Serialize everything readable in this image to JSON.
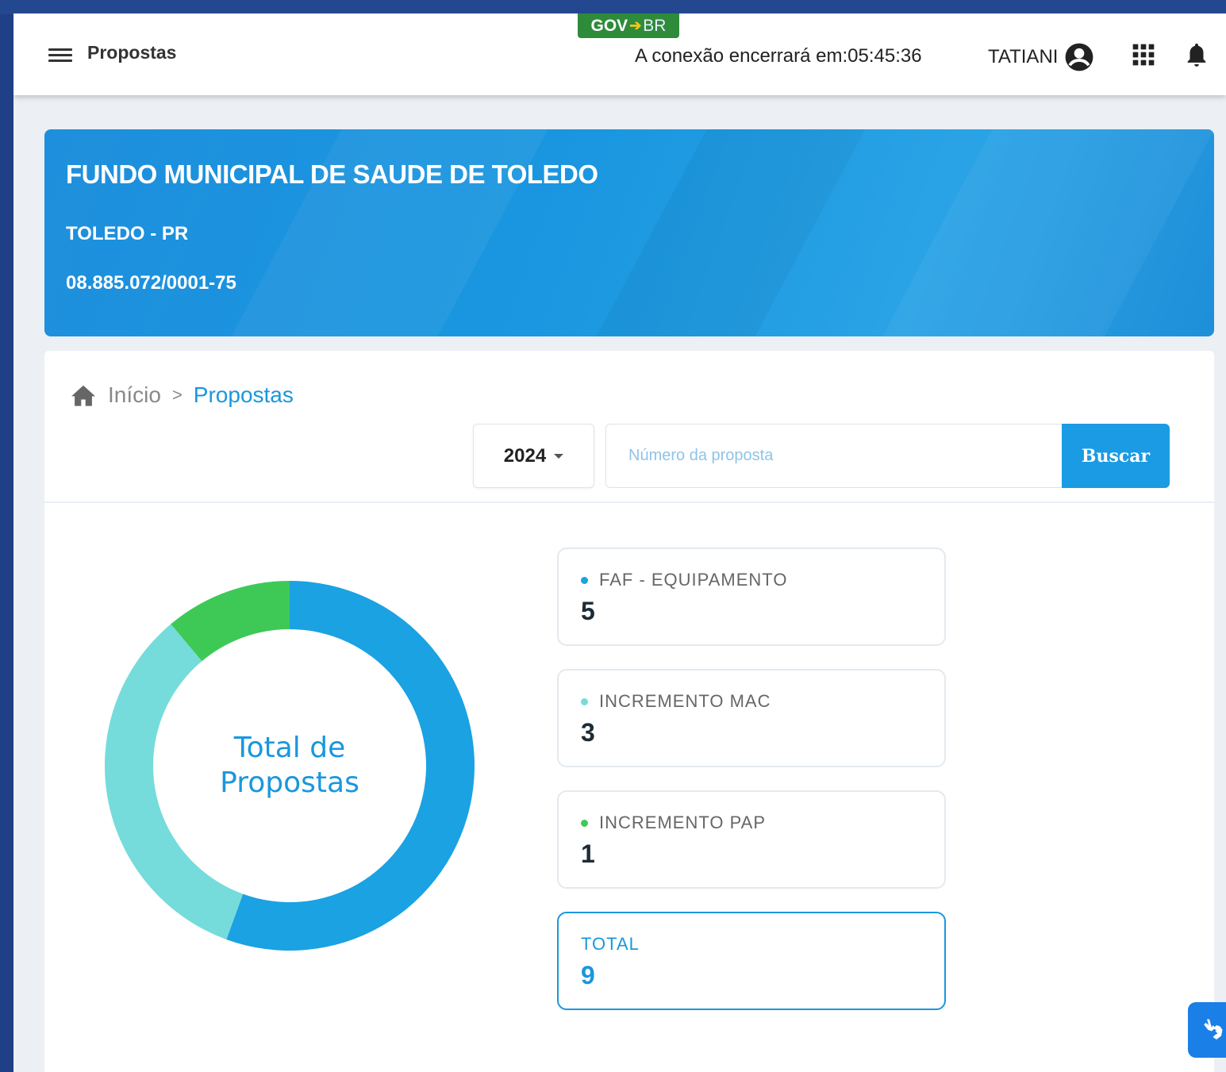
{
  "header": {
    "menu_label": "Propostas",
    "govbr_gov": "GOV",
    "govbr_br": "BR",
    "session_text": "A conexão encerrará em:05:45:36",
    "user_name": "TATIANI"
  },
  "banner": {
    "entity_name": "FUNDO MUNICIPAL DE SAUDE DE TOLEDO",
    "city": "TOLEDO - PR",
    "cnpj": "08.885.072/0001-75"
  },
  "breadcrumb": {
    "home": "Início",
    "separator": ">",
    "current": "Propostas"
  },
  "filters": {
    "year": "2024",
    "search_placeholder": "Número da proposta",
    "search_value": "",
    "search_button": "Buscar"
  },
  "chart_center": {
    "line1": "Total de",
    "line2": "Propostas"
  },
  "chart_data": {
    "type": "pie",
    "categories": [
      "FAF - EQUIPAMENTO",
      "INCREMENTO MAC",
      "INCREMENTO PAP"
    ],
    "values": [
      5,
      3,
      1
    ],
    "colors": [
      "#1aa2e3",
      "#75dcdb",
      "#3ec957"
    ]
  },
  "stats": [
    {
      "label": "FAF - EQUIPAMENTO",
      "value": "5",
      "color": "#1aa2e3"
    },
    {
      "label": "INCREMENTO MAC",
      "value": "3",
      "color": "#75dcdb"
    },
    {
      "label": "INCREMENTO PAP",
      "value": "1",
      "color": "#3ec957"
    }
  ],
  "total": {
    "label": "TOTAL",
    "value": "9"
  },
  "icons": {
    "menu": "hamburger-icon",
    "user": "account-circle-icon",
    "apps": "apps-grid-icon",
    "notifications": "bell-icon",
    "home": "home-icon",
    "accessibility": "vlibras-hands-icon"
  },
  "colors": {
    "primary": "#1a97dd",
    "banner": "#1e8fdc",
    "govbr_green": "#2e8b3a"
  }
}
